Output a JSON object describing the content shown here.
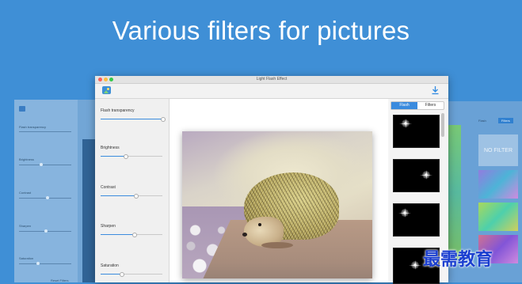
{
  "headline": "Various filters for pictures",
  "window": {
    "title": "Light Flash Effect"
  },
  "sidebar": {
    "params": [
      {
        "label": "Flash transparency",
        "value": 1.0
      },
      {
        "label": "Brightness",
        "value": 0.4
      },
      {
        "label": "Contrast",
        "value": 0.57
      },
      {
        "label": "Sharpen",
        "value": 0.54
      },
      {
        "label": "Saturation",
        "value": 0.33
      }
    ]
  },
  "panel": {
    "tabs": [
      "Flash",
      "Filters"
    ],
    "active_tab": "Flash"
  },
  "bg_left": {
    "labels": [
      "Flash transparency",
      "Brightness",
      "Contrast",
      "Sharpen",
      "Saturation"
    ],
    "button": "Reset Filters"
  },
  "bg_right": {
    "tabs": [
      "Flash",
      "Filters"
    ],
    "nofilter": "NO FILTER"
  },
  "watermark": "最需教育",
  "colors": {
    "background": "#3f8fd6",
    "accent": "#3a8bde"
  },
  "icons": [
    "app-icon",
    "download-icon"
  ]
}
